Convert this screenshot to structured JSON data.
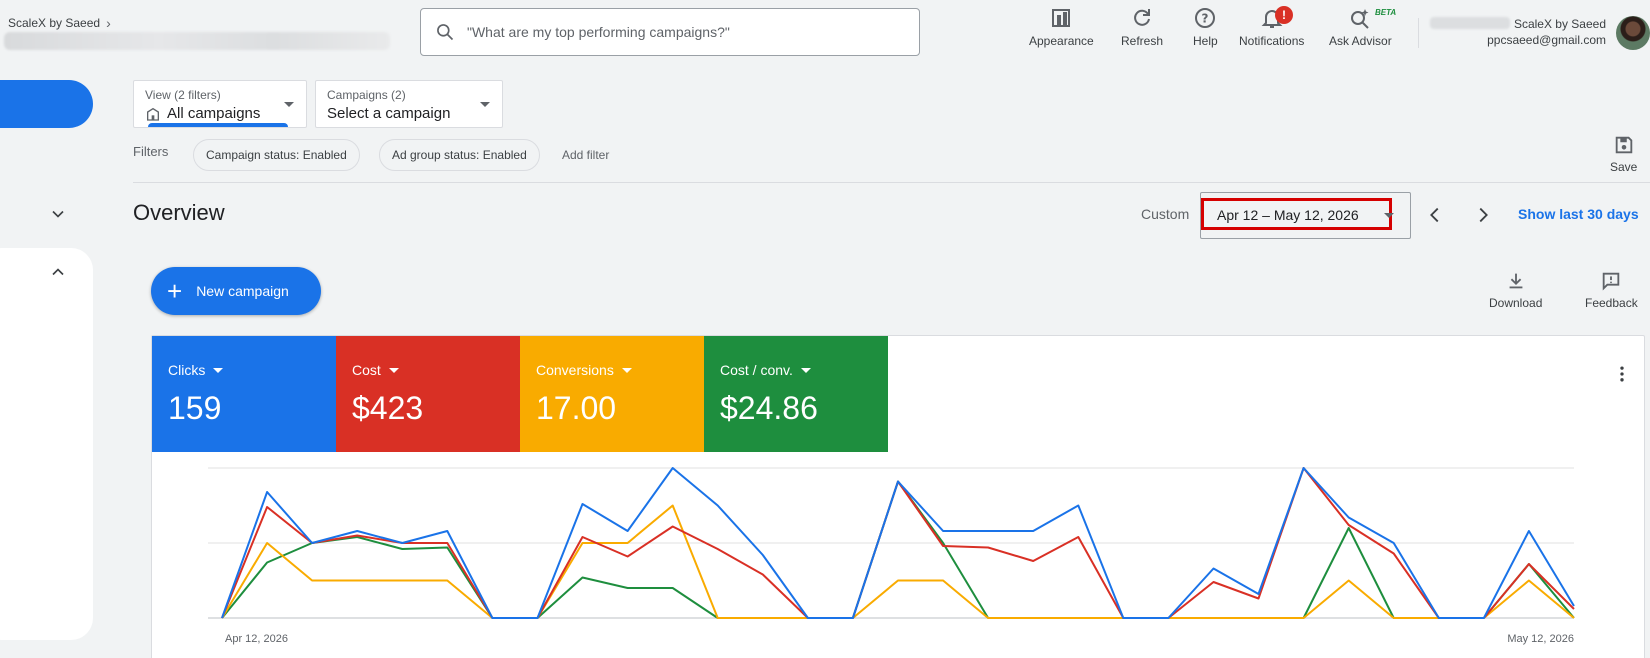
{
  "header": {
    "account_crumb": "ScaleX by Saeed",
    "search_placeholder": "\"What are my top performing campaigns?\"",
    "buttons": [
      {
        "id": "appearance",
        "label": "Appearance"
      },
      {
        "id": "refresh",
        "label": "Refresh"
      },
      {
        "id": "help",
        "label": "Help"
      },
      {
        "id": "notifications",
        "label": "Notifications",
        "badge": "!"
      },
      {
        "id": "ask-advisor",
        "label": "Ask Advisor",
        "tag": "BETA"
      }
    ],
    "account_name": "ScaleX by Saeed",
    "account_email": "ppcsaeed@gmail.com"
  },
  "filters": {
    "view_label": "View (2 filters)",
    "view_value": "All campaigns",
    "campaigns_label": "Campaigns (2)",
    "campaigns_value": "Select a campaign",
    "filters_label": "Filters",
    "chips": [
      "Campaign status: Enabled",
      "Ad group status: Enabled"
    ],
    "add_filter": "Add filter",
    "save_label": "Save"
  },
  "overview": {
    "title": "Overview",
    "custom_label": "Custom",
    "date_range": "Apr 12 – May 12, 2026",
    "show_last": "Show last 30 days",
    "new_campaign": "New campaign",
    "download": "Download",
    "feedback": "Feedback"
  },
  "metrics": [
    {
      "label": "Clicks",
      "value": "159",
      "color": "#1a73e8"
    },
    {
      "label": "Cost",
      "value": "$423",
      "color": "#d93025"
    },
    {
      "label": "Conversions",
      "value": "17.00",
      "color": "#f9ab00"
    },
    {
      "label": "Cost / conv.",
      "value": "$24.86",
      "color": "#1e8e3e"
    }
  ],
  "chart_data": {
    "type": "line",
    "x_start_label": "Apr 12, 2026",
    "x_end_label": "May 12, 2026",
    "x": [
      "Apr 12",
      "Apr 13",
      "Apr 14",
      "Apr 15",
      "Apr 16",
      "Apr 17",
      "Apr 18",
      "Apr 19",
      "Apr 20",
      "Apr 21",
      "Apr 22",
      "Apr 23",
      "Apr 24",
      "Apr 25",
      "Apr 26",
      "Apr 27",
      "Apr 28",
      "Apr 29",
      "Apr 30",
      "May 1",
      "May 2",
      "May 3",
      "May 4",
      "May 5",
      "May 6",
      "May 7",
      "May 8",
      "May 9",
      "May 10",
      "May 11",
      "May 12"
    ],
    "ylim": [
      0,
      1
    ],
    "grid": true,
    "series": [
      {
        "name": "Clicks",
        "color": "#1a73e8",
        "values": [
          0,
          0.84,
          0.5,
          0.58,
          0.5,
          0.58,
          0,
          0,
          0.76,
          0.58,
          1.0,
          0.75,
          0.42,
          0,
          0,
          0.91,
          0.58,
          0.58,
          0.58,
          0.75,
          0,
          0,
          0.33,
          0.16,
          1.0,
          0.67,
          0.5,
          0,
          0,
          0.58,
          0.08
        ]
      },
      {
        "name": "Cost",
        "color": "#d93025",
        "values": [
          0,
          0.74,
          0.5,
          0.55,
          0.5,
          0.5,
          0,
          0,
          0.54,
          0.41,
          0.61,
          0.46,
          0.29,
          0,
          0,
          0.91,
          0.48,
          0.47,
          0.38,
          0.54,
          0,
          0,
          0.24,
          0.13,
          1.0,
          0.62,
          0.43,
          0,
          0,
          0.36,
          0.06
        ]
      },
      {
        "name": "Conversions",
        "color": "#f9ab00",
        "values": [
          0,
          0.5,
          0.25,
          0.25,
          0.25,
          0.25,
          0,
          0,
          0.5,
          0.5,
          0.75,
          0,
          0,
          0,
          0,
          0.25,
          0.25,
          0,
          0,
          0,
          0,
          0,
          0,
          0,
          0,
          0.25,
          0,
          0,
          0,
          0.25,
          0
        ]
      },
      {
        "name": "Cost / conv.",
        "color": "#1e8e3e",
        "values": [
          0,
          0.37,
          0.5,
          0.54,
          0.46,
          0.47,
          0,
          0,
          0.27,
          0.2,
          0.2,
          0,
          0,
          0,
          0,
          0.91,
          0.5,
          0,
          0,
          0,
          0,
          0,
          0,
          0,
          0,
          0.6,
          0,
          0,
          0,
          0.36,
          0
        ]
      }
    ]
  }
}
